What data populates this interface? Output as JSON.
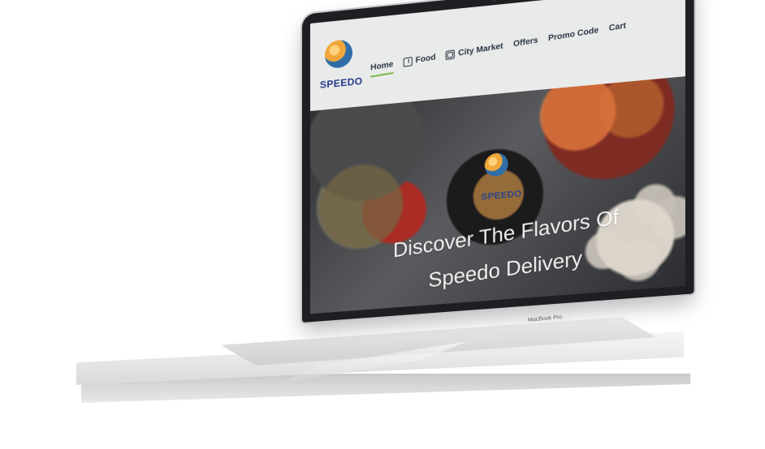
{
  "device": {
    "brand_label": "MacBook Pro"
  },
  "site": {
    "logo_text": "SPEEDO",
    "nav_items": [
      {
        "label": "Home",
        "active": true
      },
      {
        "label": "Food",
        "active": false,
        "icon": "food-icon"
      },
      {
        "label": "City Market",
        "active": false,
        "icon": "market-icon"
      },
      {
        "label": "Offers",
        "active": false
      },
      {
        "label": "Promo Code",
        "active": false
      },
      {
        "label": "Cart",
        "active": false
      }
    ],
    "hero_logo_text": "SPEEDO",
    "headline_line_1": "Discover The Flavors Of",
    "headline_line_2": "Speedo Delivery"
  },
  "colors": {
    "accent": "#7ab648",
    "nav_bg": "#e9eaea",
    "brand_blue": "#253a8a"
  }
}
